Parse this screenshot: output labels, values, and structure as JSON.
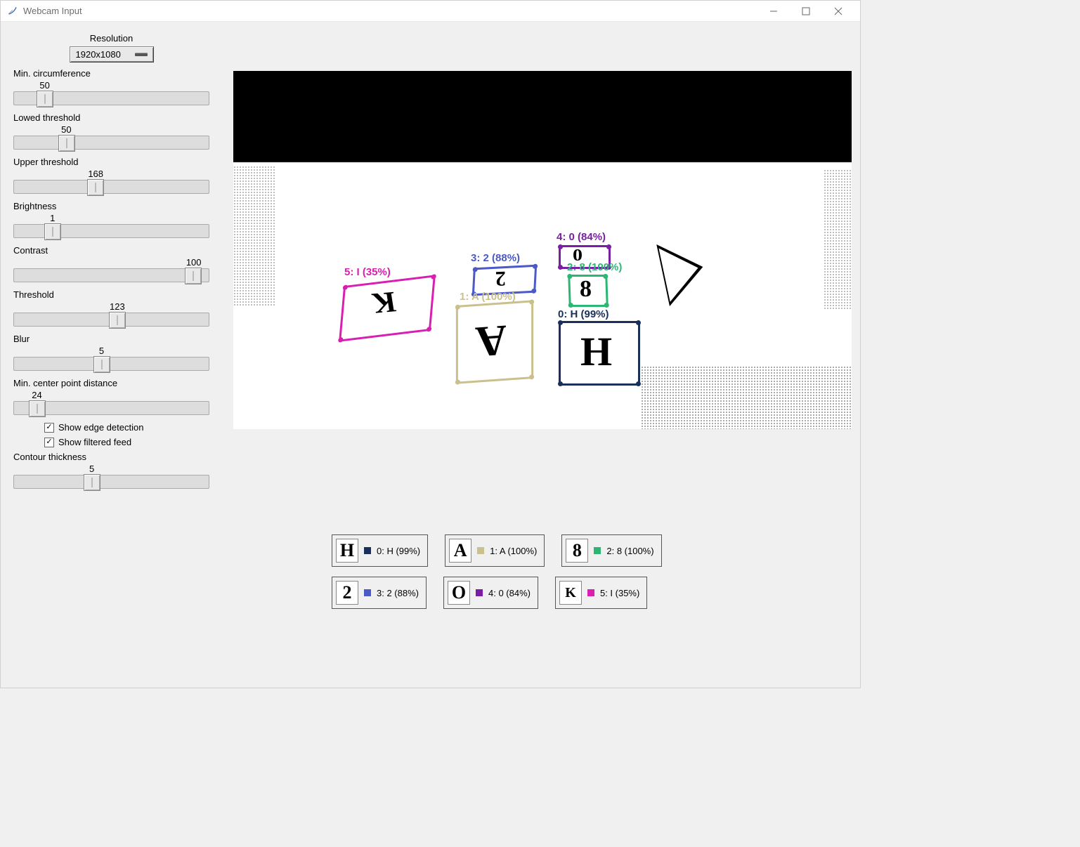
{
  "window": {
    "title": "Webcam Input"
  },
  "resolution": {
    "label": "Resolution",
    "value": "1920x1080"
  },
  "sliders": {
    "min_circ": {
      "label": "Min. circumference",
      "value": 50,
      "pct": 16
    },
    "lower_th": {
      "label": "Lowed threshold",
      "value": 50,
      "pct": 27
    },
    "upper_th": {
      "label": "Upper threshold",
      "value": 168,
      "pct": 42
    },
    "brightness": {
      "label": "Brightness",
      "value": 1,
      "pct": 20
    },
    "contrast": {
      "label": "Contrast",
      "value": 100,
      "pct": 92
    },
    "threshold": {
      "label": "Threshold",
      "value": 123,
      "pct": 53
    },
    "blur": {
      "label": "Blur",
      "value": 5,
      "pct": 45
    },
    "min_center": {
      "label": "Min. center point distance",
      "value": 24,
      "pct": 12
    },
    "contour": {
      "label": "Contour thickness",
      "value": 5,
      "pct": 40
    }
  },
  "checks": {
    "edge": {
      "label": "Show edge detection",
      "checked": true
    },
    "filtered": {
      "label": "Show filtered feed",
      "checked": true
    }
  },
  "overlay": {
    "d5": "5: I (35%)",
    "d3": "3: 2 (88%)",
    "d4": "4: 0 (84%)",
    "d2": "2: 8 (100%)",
    "d1": "1: A (100%)",
    "d0": "0: H (99%)"
  },
  "colors": {
    "navy": "#1a2f5a",
    "tan": "#c9c08e",
    "green": "#2bb673",
    "blue": "#4b59c9",
    "purple": "#7a1ea5",
    "magenta": "#d81fb0"
  },
  "results": [
    {
      "glyph": "H",
      "color": "#1a2f5a",
      "text": "0: H (99%)"
    },
    {
      "glyph": "A",
      "color": "#c9c08e",
      "text": "1: A (100%)"
    },
    {
      "glyph": "8",
      "color": "#2bb673",
      "text": "2: 8 (100%)"
    },
    {
      "glyph": "2",
      "color": "#4b59c9",
      "text": "3: 2 (88%)"
    },
    {
      "glyph": "O",
      "color": "#7a1ea5",
      "text": "4: 0 (84%)"
    },
    {
      "glyph": "K",
      "color": "#d81fb0",
      "text": "5: I (35%)"
    }
  ]
}
